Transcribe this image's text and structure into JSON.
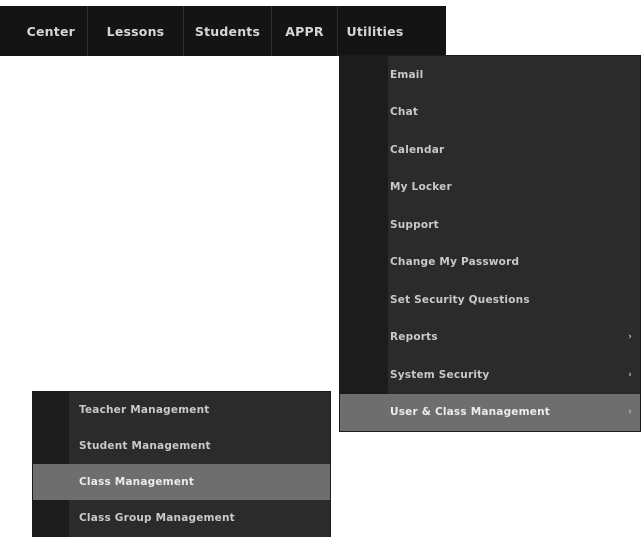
{
  "nav": {
    "items": [
      {
        "label": "Center"
      },
      {
        "label": "Lessons"
      },
      {
        "label": "Students"
      },
      {
        "label": "APPR"
      },
      {
        "label": "Utilities"
      }
    ]
  },
  "utilities_menu": {
    "items": [
      {
        "label": "Email",
        "has_submenu": false
      },
      {
        "label": "Chat",
        "has_submenu": false
      },
      {
        "label": "Calendar",
        "has_submenu": false
      },
      {
        "label": "My Locker",
        "has_submenu": false
      },
      {
        "label": "Support",
        "has_submenu": false
      },
      {
        "label": "Change My Password",
        "has_submenu": false
      },
      {
        "label": "Set Security Questions",
        "has_submenu": false
      },
      {
        "label": "Reports",
        "has_submenu": true
      },
      {
        "label": "System Security",
        "has_submenu": true
      },
      {
        "label": "User & Class Management",
        "has_submenu": true,
        "highlighted": true
      }
    ],
    "arrow_glyph": "›"
  },
  "user_class_submenu": {
    "items": [
      {
        "label": "Teacher Management"
      },
      {
        "label": "Student Management"
      },
      {
        "label": "Class Management",
        "highlighted": true
      },
      {
        "label": "Class Group Management"
      }
    ]
  },
  "colors": {
    "nav_bg": "#141414",
    "menu_bg": "#2b2b2b",
    "menu_gutter": "#1c1c1c",
    "highlight": "#6e6e6e",
    "text": "#c9c9c9"
  }
}
